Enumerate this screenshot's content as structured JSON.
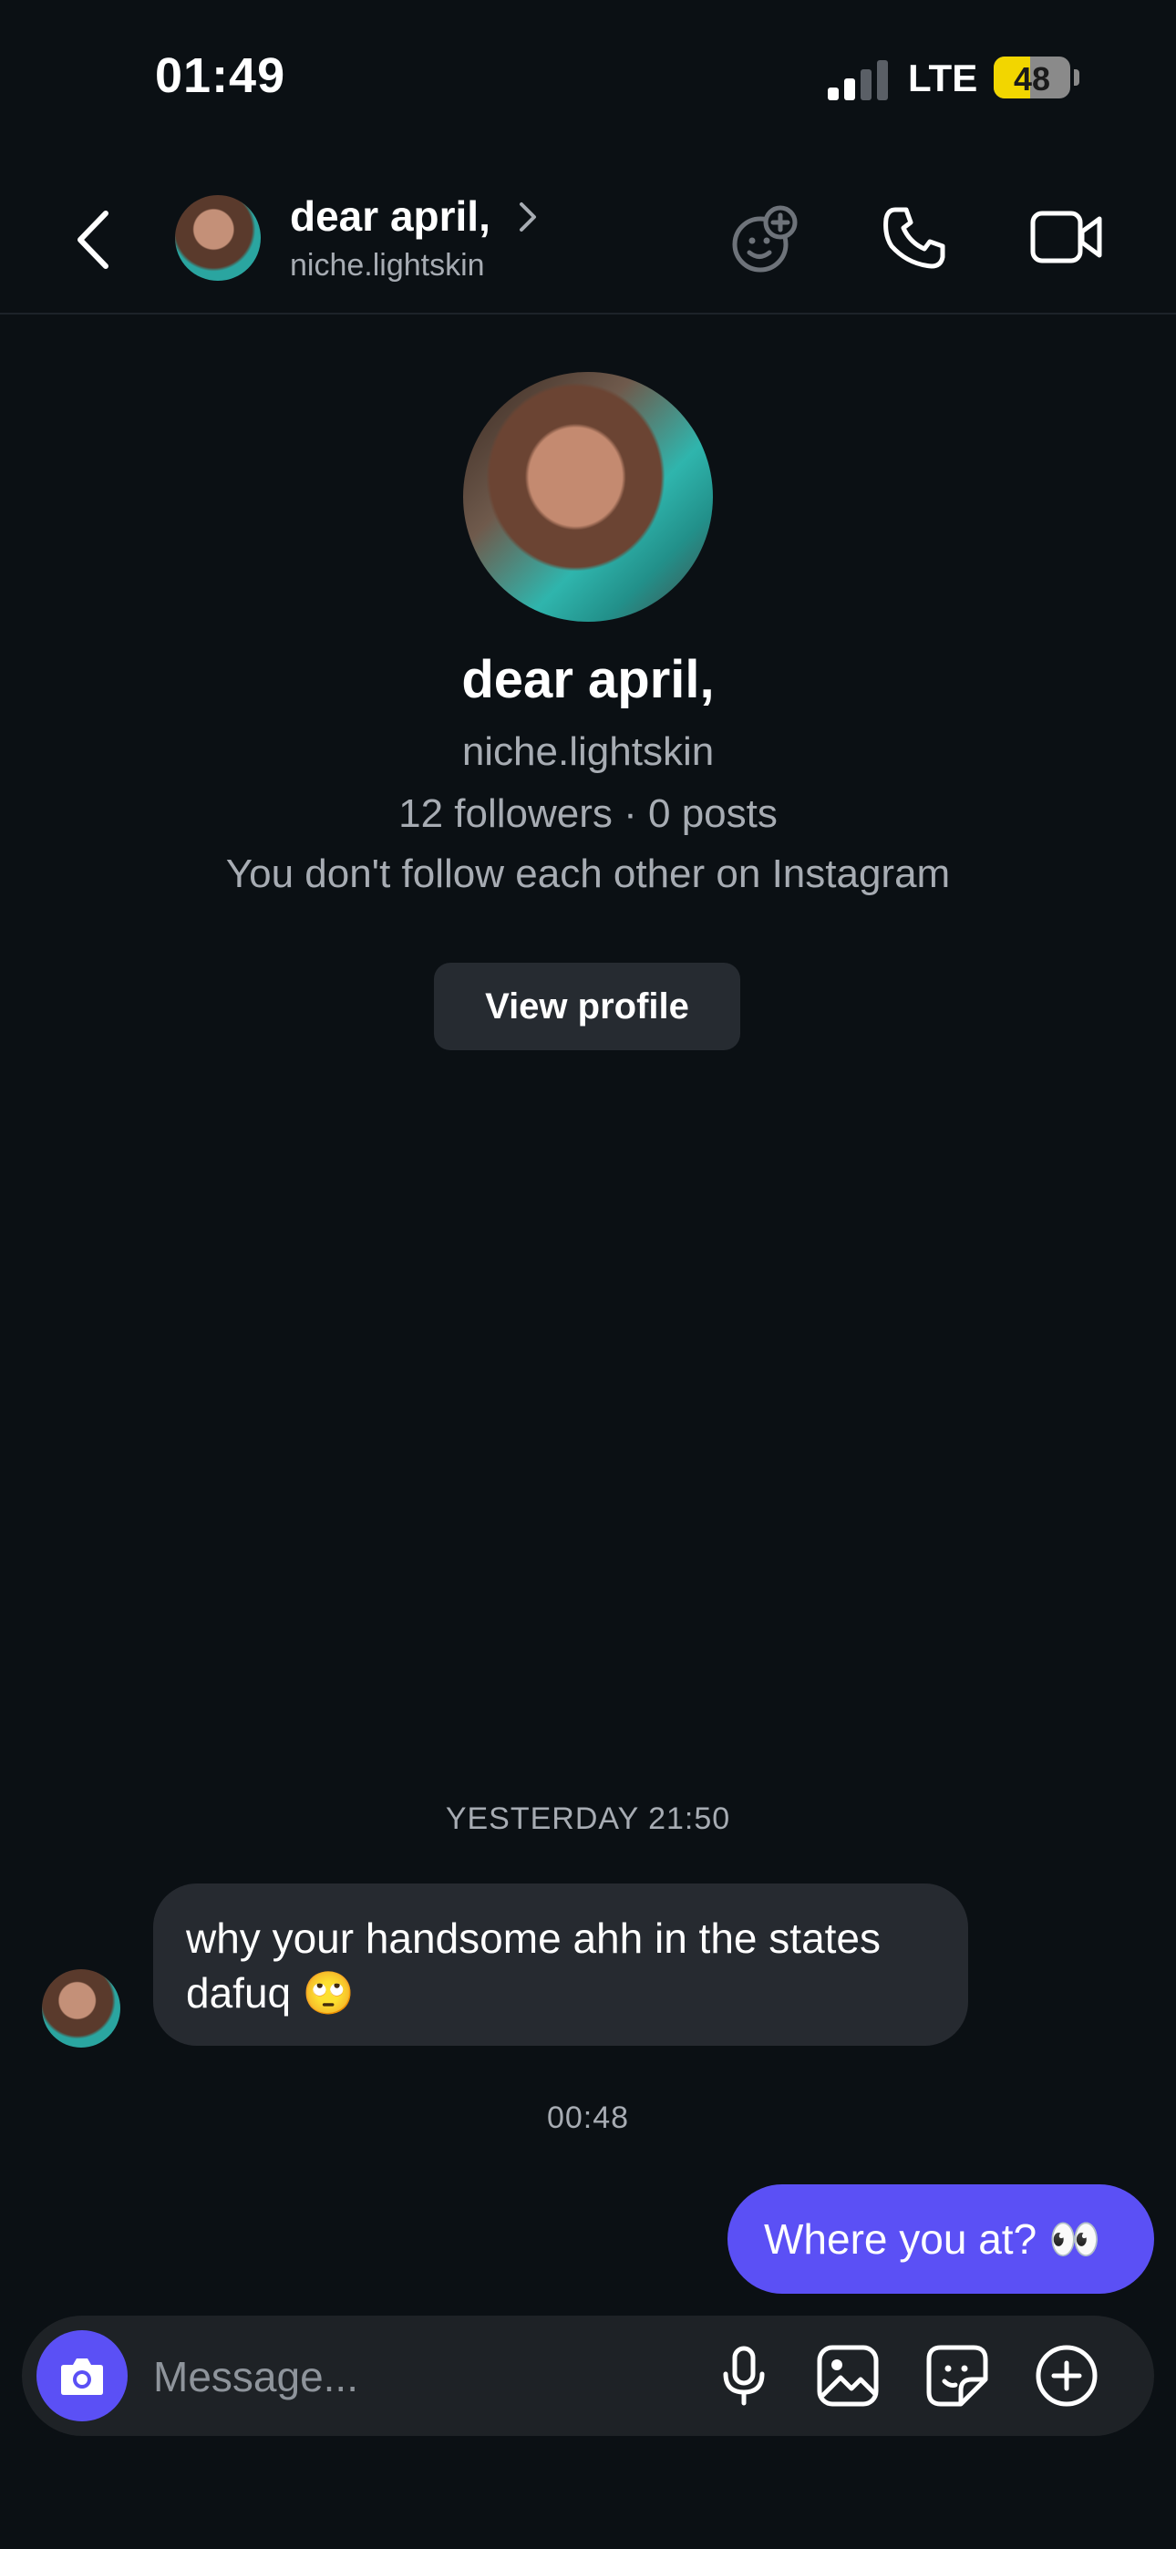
{
  "status_bar": {
    "time": "01:49",
    "network": "LTE",
    "battery": "48"
  },
  "header": {
    "name": "dear april,",
    "username": "niche.lightskin",
    "icons": [
      "back-icon",
      "effects-icon",
      "phone-icon",
      "video-icon"
    ]
  },
  "profile": {
    "name": "dear april,",
    "username": "niche.lightskin",
    "stats": "12 followers · 0 posts",
    "follow_status": "You don't follow each other on Instagram",
    "view_profile_label": "View profile"
  },
  "messages": [
    {
      "timestamp": "YESTERDAY 21:50",
      "direction": "incoming",
      "text": "why your handsome ahh in the states dafuq 🙄"
    },
    {
      "timestamp": "00:48",
      "direction": "outgoing",
      "text": "Where you at? 👀"
    }
  ],
  "composer": {
    "placeholder": "Message...",
    "icons": [
      "camera-icon",
      "microphone-icon",
      "gallery-icon",
      "sticker-icon",
      "plus-icon"
    ]
  },
  "colors": {
    "background": "#0b1014",
    "outgoing_bubble": "#5b50f5",
    "incoming_bubble": "#262a30",
    "secondary_text": "#a7acb3",
    "battery_fill": "#f2d600"
  }
}
